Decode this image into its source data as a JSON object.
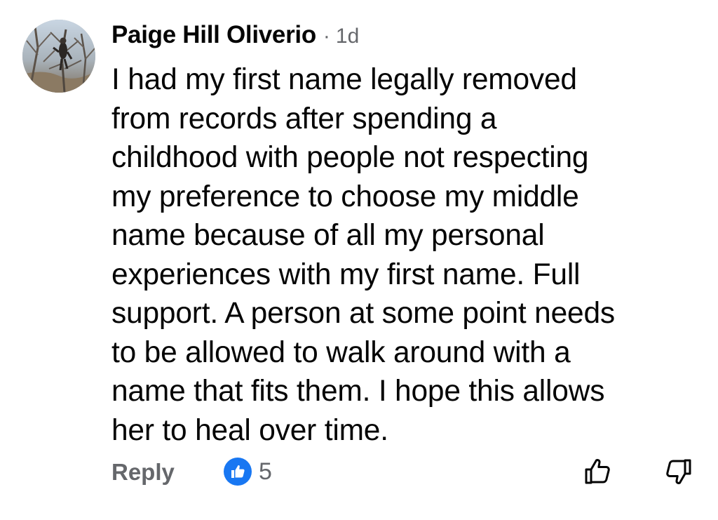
{
  "comment": {
    "author": "Paige Hill Oliverio",
    "separator": "·",
    "time": "1d",
    "text": "I had my first name legally removed from records after spending a childhood with people not respecting my preference to choose my middle name because of all my personal experiences with my first name. Full support. A person at some point needs to be allowed to walk around with a name that fits them. I hope this allows her to heal over time.",
    "lines": [
      "I had my first name legally removed",
      "from records after spending a",
      "childhood with people not respecting",
      "my preference to choose my middle",
      "name because of all my personal",
      "experiences with my first name. Full",
      "support. A person at some point needs",
      "to be allowed to walk around with a",
      "name that fits them. I hope this allows",
      "her to heal over time."
    ]
  },
  "actions": {
    "reply_label": "Reply",
    "reaction_count": "5",
    "reaction_icon": "like-thumbs-up-icon",
    "upvote_icon": "thumbs-up-outline-icon",
    "downvote_icon": "thumbs-down-outline-icon"
  },
  "colors": {
    "text": "#050505",
    "secondary": "#65676b",
    "like_blue": "#1877f2"
  }
}
